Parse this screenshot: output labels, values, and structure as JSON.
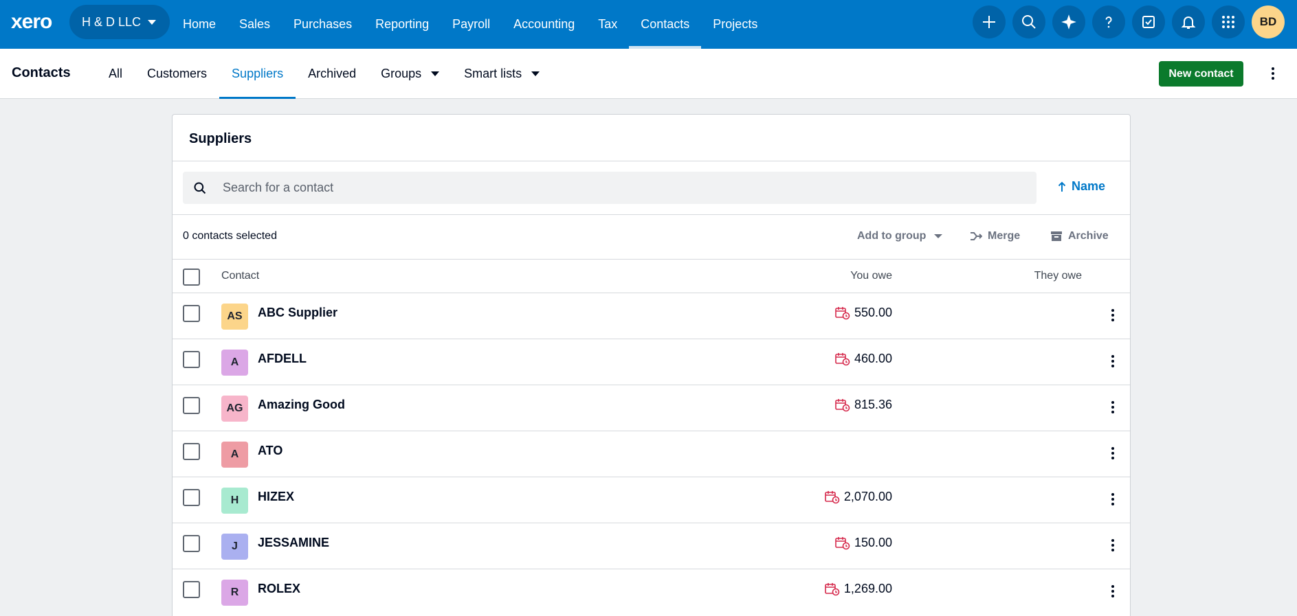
{
  "app": {
    "logo": "xero",
    "org_name": "H & D LLC",
    "user_initials": "BD"
  },
  "nav": {
    "items": [
      "Home",
      "Sales",
      "Purchases",
      "Reporting",
      "Payroll",
      "Accounting",
      "Tax",
      "Contacts",
      "Projects"
    ],
    "active": "Contacts"
  },
  "subnav": {
    "title": "Contacts",
    "tabs": [
      "All",
      "Customers",
      "Suppliers",
      "Archived",
      "Groups",
      "Smart lists"
    ],
    "active": "Suppliers",
    "new_contact_label": "New contact"
  },
  "card": {
    "title": "Suppliers",
    "search_placeholder": "Search for a contact",
    "sort_label": "Name",
    "selected_text": "0 contacts selected",
    "actions": {
      "add_to_group": "Add to group",
      "merge": "Merge",
      "archive": "Archive"
    },
    "columns": {
      "contact": "Contact",
      "you_owe": "You owe",
      "they_owe": "They owe"
    },
    "rows": [
      {
        "initials": "AS",
        "name": "ABC Supplier",
        "you_owe": "550.00",
        "color": "#fcd58a"
      },
      {
        "initials": "A",
        "name": "AFDELL",
        "you_owe": "460.00",
        "color": "#dba7e6"
      },
      {
        "initials": "AG",
        "name": "Amazing Good",
        "you_owe": "815.36",
        "color": "#f7b5ca"
      },
      {
        "initials": "A",
        "name": "ATO",
        "you_owe": "",
        "color": "#ee9ca4"
      },
      {
        "initials": "H",
        "name": "HIZEX",
        "you_owe": "2,070.00",
        "color": "#a8ead0"
      },
      {
        "initials": "J",
        "name": "JESSAMINE",
        "you_owe": "150.00",
        "color": "#aab0f0"
      },
      {
        "initials": "R",
        "name": "ROLEX",
        "you_owe": "1,269.00",
        "color": "#dba7e6"
      }
    ]
  },
  "colors": {
    "brand": "#0078c8",
    "primary_button": "#0b7a2c",
    "overdue_icon": "#d5284b"
  }
}
